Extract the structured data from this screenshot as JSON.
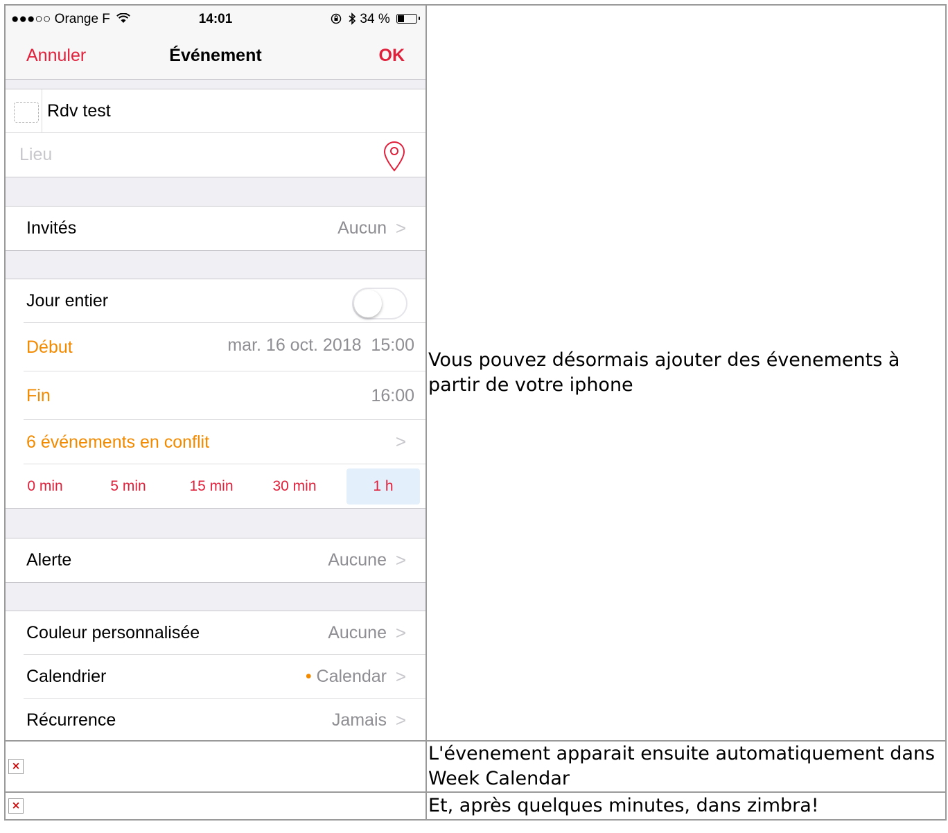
{
  "status_bar": {
    "carrier": "●●●○○ Orange F",
    "time": "14:01",
    "battery": "34 %"
  },
  "nav": {
    "cancel": "Annuler",
    "title": "Événement",
    "ok": "OK"
  },
  "event": {
    "title": "Rdv test",
    "location_placeholder": "Lieu"
  },
  "invitees": {
    "label": "Invités",
    "value": "Aucun"
  },
  "all_day": {
    "label": "Jour entier",
    "enabled": false
  },
  "start": {
    "label": "Début",
    "value": "mar. 16 oct. 2018  15:00"
  },
  "end": {
    "label": "Fin",
    "value": "16:00"
  },
  "conflicts": {
    "label": "6 événements en conflit"
  },
  "durations": {
    "options": [
      "0 min",
      "5 min",
      "15 min",
      "30 min",
      "1 h"
    ],
    "selected": "1 h"
  },
  "alert": {
    "label": "Alerte",
    "value": "Aucune"
  },
  "custom_color": {
    "label": "Couleur personnalisée",
    "value": "Aucune"
  },
  "calendar": {
    "label": "Calendrier",
    "dot": "•",
    "value": "Calendar"
  },
  "recurrence": {
    "label": "Récurrence",
    "value": "Jamais"
  },
  "descriptions": {
    "step1": "Vous pouvez désormais ajouter des évenements à partir de votre iphone",
    "step2": "L'évenement apparait ensuite automatiquement dans Week Calendar",
    "step3": "Et, après quelques minutes, dans zimbra!"
  },
  "colors": {
    "accent_red": "#e0213c",
    "accent_orange": "#f28a00",
    "selected_bg": "#e4effc"
  }
}
